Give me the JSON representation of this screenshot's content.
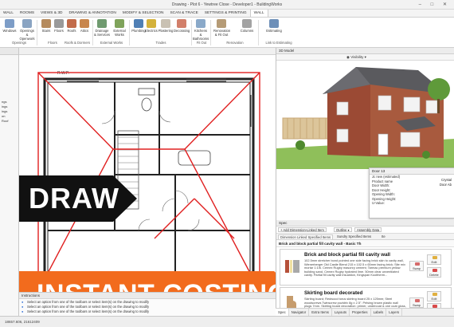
{
  "window": {
    "title": "Drawing - Plot 6 - Yewtree Close - Developer1 - BuildingWorks",
    "controls": "– □ ✕"
  },
  "ribbon_tabs": [
    "WALL",
    "ROOMS",
    "VIEWS & 3D",
    "DRAWING & ANNOTATION",
    "MODIFY & SELECTION",
    "SCAN & TRACE",
    "SETTINGS & PRINTING",
    "WALL"
  ],
  "ribbon_buttons": [
    {
      "label": "Windows",
      "icon_color": "#7d9dc7"
    },
    {
      "label": "Openings & Openwork",
      "icon_color": "#8aa4c2"
    },
    {
      "label": "Stairs",
      "icon_color": "#b58b5e"
    },
    {
      "label": "Floors",
      "icon_color": "#9a9a9a"
    },
    {
      "label": "Roofs",
      "icon_color": "#c26b4a"
    },
    {
      "label": "Attics",
      "icon_color": "#c8864d"
    },
    {
      "label": "Drainage & Services",
      "icon_color": "#6f9a6f"
    },
    {
      "label": "External Works",
      "icon_color": "#7fa35b"
    },
    {
      "label": "Plumbing",
      "icon_color": "#4f7fb5"
    },
    {
      "label": "Electrics",
      "icon_color": "#d4b23b"
    },
    {
      "label": "Plastering",
      "icon_color": "#c9c1b3"
    },
    {
      "label": "Decorating",
      "icon_color": "#d27f6a"
    },
    {
      "label": "Kitchens & Bathrooms",
      "icon_color": "#8aa9c9"
    },
    {
      "label": "Renovation & Fit Out",
      "icon_color": "#b59b76"
    },
    {
      "label": "Columns",
      "icon_color": "#a3a3a3"
    },
    {
      "label": "Estimating",
      "icon_color": "#6d8fb8"
    }
  ],
  "ribbon_groups": [
    "Openings",
    "Floors",
    "Roofs & Dormers",
    "External Works",
    "Trades",
    "Fit Out",
    "Renovation",
    "Link to Estimating"
  ],
  "left_panel": {
    "items": [
      "ngs",
      "ings",
      "ings",
      "on",
      "Roof"
    ]
  },
  "banners": {
    "draw": "DRAW",
    "costing": "INSTANT COSTING"
  },
  "drawing": {
    "label": "R.W.P."
  },
  "instructions": {
    "title": "Instructions",
    "rows": [
      "Select an option from one of the toolbars or select item(s) on the drawing to modify",
      "Select an option from one of the toolbars or select item(s) on the drawing to modify",
      "Select an option from one of the toolbars or select item(s) on the drawing to modify"
    ]
  },
  "status": "18657.606, 21612409",
  "right_panel": {
    "title": "3D Model",
    "visibility_label": "Visibility",
    "door_popup": {
      "title": "Door 13",
      "rows": [
        {
          "k": "",
          "v": "Jc new (estimated)"
        },
        {
          "k": "",
          "v": "Product name"
        },
        {
          "k": "Door Width:",
          "v": ""
        },
        {
          "k": "Door Height:",
          "v": ""
        },
        {
          "k": "Opening Width:",
          "v": ""
        },
        {
          "k": "Opening Height:",
          "v": ""
        },
        {
          "k": "U-Value:",
          "v": ""
        }
      ],
      "side_labels": [
        "Crystal",
        "Door Ab"
      ]
    }
  },
  "spec": {
    "title": "Spec",
    "buttons": [
      "Add Dimension-Linked Item",
      "Outline",
      "Assembly Data"
    ],
    "tabs": [
      "Dimension Linked Specified Items",
      "Sundry Specified Items",
      "Ite"
    ],
    "header": "Brick and block partial fill cavity wall - Basic Th",
    "items": [
      {
        "title": "Brick and block partial fill cavity wall",
        "desc": "102.5mm stretcher bond pointed one side facing brick skin to cavity wall, Wienerberger Old Castle Blend 215 x 102.5 x 65mm facing brick; Site mix mortar 1:1/6. Cemex Rugby masonry cement; Tarmac premium yellow building sand, Cemex Rugby hydrated lime. 50mm clear unventilated cavity. Partial fill cavity wall insulation, Kingspan Kooltherm..."
      },
      {
        "title": "Skirting board decorated",
        "desc": "Skirting board; Redwood torus skirting board 25 x 125mm; Steel woodscrews Twinscrew pozidriv 8g x 2.5\". Pelsing brown plastic wall plugs 7mm. Skirting board decoration: primer, undercoat & one coat gloss, Dulux Trade undercoat white and Dulux all purpose primer"
      }
    ],
    "actions": {
      "swap": "Swap",
      "edit": "Edit",
      "delete": "Delete"
    }
  },
  "bottom_tabs": [
    "Spec",
    "Navigator",
    "Extra Items",
    "Layouts",
    "Properties",
    "Labels",
    "Layers"
  ]
}
